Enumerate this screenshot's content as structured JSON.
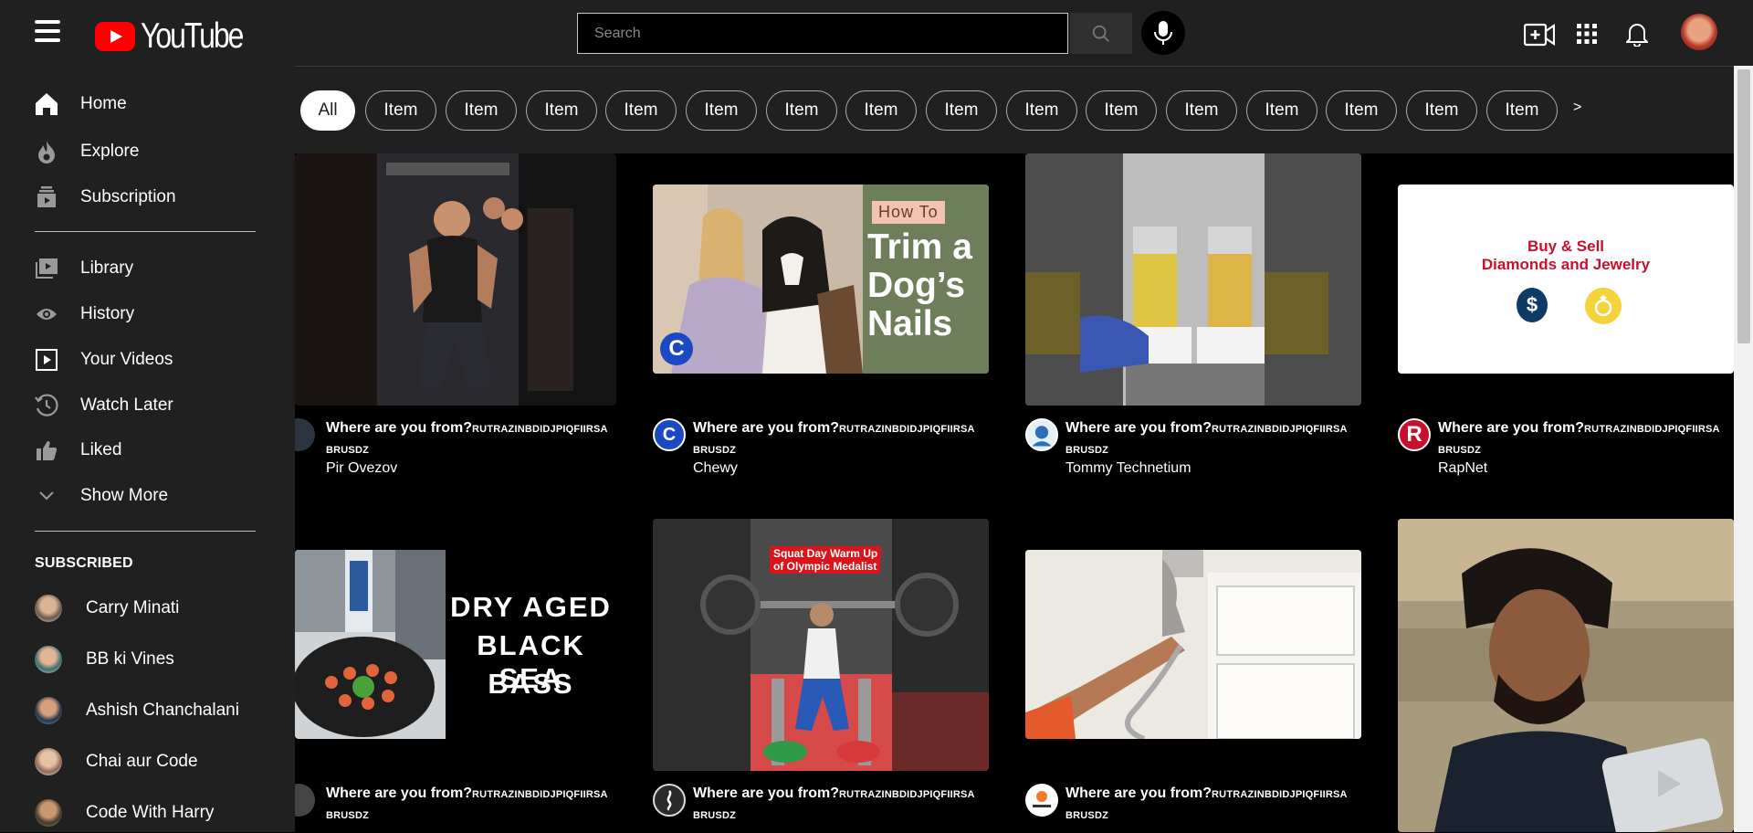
{
  "header": {
    "logo_text": "YouTube",
    "search_placeholder": "Search"
  },
  "sidebar": {
    "main": [
      {
        "label": "Home",
        "icon": "home-icon"
      },
      {
        "label": "Explore",
        "icon": "explore-icon"
      },
      {
        "label": "Subscription",
        "icon": "subscriptions-icon"
      }
    ],
    "library": [
      {
        "label": "Library",
        "icon": "library-icon"
      },
      {
        "label": "History",
        "icon": "history-icon"
      },
      {
        "label": "Your Videos",
        "icon": "your-videos-icon"
      },
      {
        "label": "Watch Later",
        "icon": "watch-later-icon"
      },
      {
        "label": "Liked",
        "icon": "like-icon"
      },
      {
        "label": "Show More",
        "icon": "chevron-down-icon"
      }
    ],
    "subscribed_heading": "SUBSCRIBED",
    "subscribed": [
      {
        "label": "Carry Minati"
      },
      {
        "label": "BB ki Vines"
      },
      {
        "label": "Ashish Chanchalani"
      },
      {
        "label": "Chai aur Code"
      },
      {
        "label": "Code With Harry"
      }
    ]
  },
  "chips": [
    "All",
    "Item",
    "Item",
    "Item",
    "Item",
    "Item",
    "Item",
    "Item",
    "Item",
    "Item",
    "Item",
    "Item",
    "Item",
    "Item",
    "Item",
    "Item"
  ],
  "chip_next": ">",
  "videos": [
    {
      "title": "Where are you from?",
      "title_suffix": "RUTRAZINBDIDJPIQFIIRSA",
      "title_line2": "BRUSDZ",
      "channel": "Pir Ovezov"
    },
    {
      "title": "Where are you from?",
      "title_suffix": "RUTRAZINBDIDJPIQFIIRSA",
      "title_line2": "BRUSDZ",
      "channel": "Chewy",
      "thumb_text": {
        "tag": "How To",
        "line1": "Trim a",
        "line2": "Dog’s",
        "line3": "Nails"
      }
    },
    {
      "title": "Where are you from?",
      "title_suffix": "RUTRAZINBDIDJPIQFIIRSA",
      "title_line2": "BRUSDZ",
      "channel": "Tommy Technetium"
    },
    {
      "title": "Where are you from?",
      "title_suffix": "RUTRAZINBDIDJPIQFIIRSA",
      "title_line2": "BRUSDZ",
      "channel": "RapNet",
      "thumb_text": {
        "line1": "Buy & Sell",
        "line2": "Diamonds and Jewelry"
      }
    },
    {
      "title": "Where are you from?",
      "title_suffix": "RUTRAZINBDIDJPIQFIIRSA",
      "title_line2": "BRUSDZ",
      "thumb_text": {
        "line1": "DRY AGED",
        "line2": "BLACK SEA",
        "line3": "BASS"
      }
    },
    {
      "title": "Where are you from?",
      "title_suffix": "RUTRAZINBDIDJPIQFIIRSA",
      "title_line2": "BRUSDZ",
      "thumb_text": {
        "line1": "Squat Day Warm Up",
        "line2": "of Olympic Medalist"
      }
    },
    {
      "title": "Where are you from?",
      "title_suffix": "RUTRAZINBDIDJPIQFIIRSA",
      "title_line2": "BRUSDZ"
    },
    {}
  ],
  "colors": {
    "brand": "#ff0000",
    "background": "#000000",
    "surface": "#202020"
  }
}
